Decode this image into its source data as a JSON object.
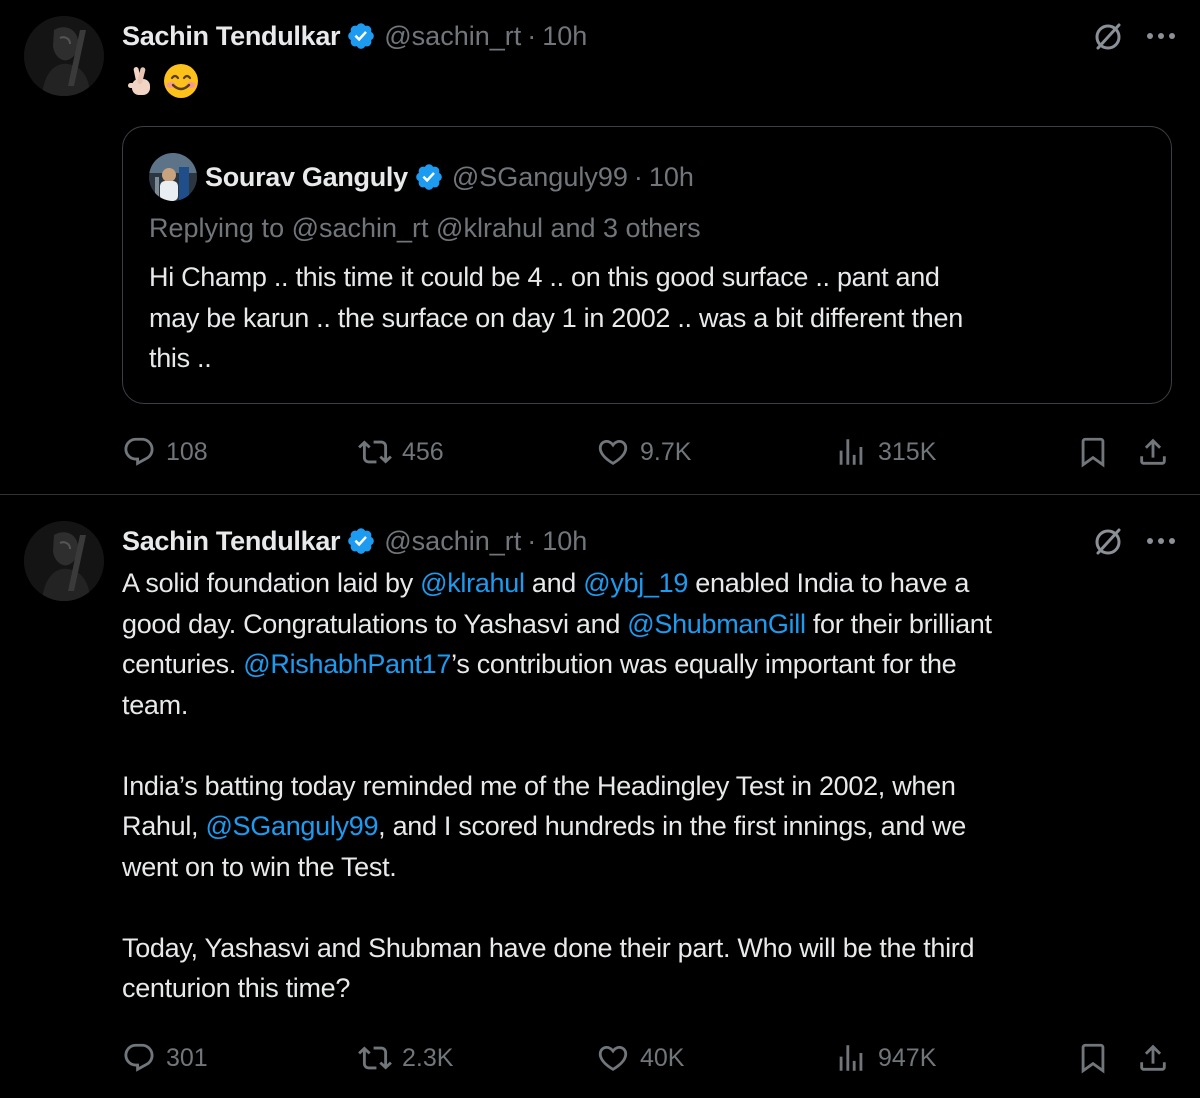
{
  "tweets": [
    {
      "author": {
        "name": "Sachin Tendulkar",
        "handle": "@sachin_rt",
        "time": "10h",
        "verified": true
      },
      "emojis": [
        "crossed-fingers-emoji",
        "smiling-face-emoji"
      ],
      "quote": {
        "author": {
          "name": "Sourav Ganguly",
          "handle": "@SGanguly99",
          "time": "10h",
          "verified": true
        },
        "replying_to": "Replying to @sachin_rt @klrahul and 3 others",
        "text_lines": [
          "Hi Champ .. this time it could be 4 .. on this good surface .. pant  and",
          "may be karun .. the surface on day 1 in 2002 .. was a bit different then",
          "this .."
        ]
      },
      "stats": {
        "replies": "108",
        "retweets": "456",
        "likes": "9.7K",
        "views": "315K"
      }
    },
    {
      "author": {
        "name": "Sachin Tendulkar",
        "handle": "@sachin_rt",
        "time": "10h",
        "verified": true
      },
      "body": {
        "l1a": "A solid foundation laid by ",
        "m1": "@klrahul",
        "l1b": " and ",
        "m2": "@ybj_19",
        "l1c": " enabled India to have a",
        "l2a": "good day. Congratulations to Yashasvi and ",
        "m3": "@ShubmanGill",
        "l2b": " for their brilliant",
        "l3a": "centuries. ",
        "m4": "@RishabhPant17",
        "l3b": "’s contribution was equally important for the",
        "l4": "team.",
        "l5": "India’s batting today reminded me of the Headingley Test in 2002, when",
        "l6a": "Rahul, ",
        "m5": "@SGanguly99",
        "l6b": ", and I scored hundreds in the first innings, and we",
        "l7": "went on to win the Test.",
        "l8": "Today, Yashasvi and Shubman have done their part. Who will be the third",
        "l9": "centurion this time?"
      },
      "stats": {
        "replies": "301",
        "retweets": "2.3K",
        "likes": "40K",
        "views": "947K"
      }
    }
  ],
  "colors": {
    "background": "#000000",
    "text": "#e7e9ea",
    "muted": "#71767b",
    "link": "#1d9bf0",
    "verified": "#1d9bf0",
    "border": "#2f3336"
  }
}
